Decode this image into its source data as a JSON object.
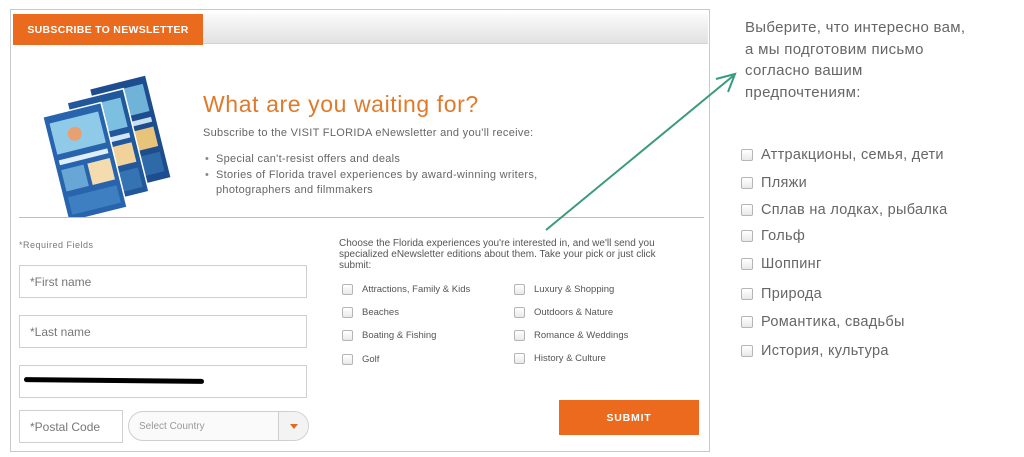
{
  "newsletter": {
    "tab_label": "SUBSCRIBE TO NEWSLETTER",
    "headline": "What are you waiting for?",
    "intro": "Subscribe to the VISIT FLORIDA eNewsletter and you'll receive:",
    "benefits": [
      {
        "lines": [
          "Special can't-resist offers and deals"
        ]
      },
      {
        "lines": [
          "Stories of Florida travel experiences by award-winning writers,",
          "photographers and filmmakers"
        ]
      }
    ],
    "accent_color": "#ea6a1e"
  },
  "form": {
    "required_label": "*Required Fields",
    "first_name_placeholder": "*First name",
    "last_name_placeholder": "*Last name",
    "postal_placeholder": "*Postal Code",
    "country_placeholder": "Select Country",
    "choose_text": [
      "Choose the Florida experiences you're interested in, and we'll send you",
      "specialized eNewsletter editions about them. Take your pick or just click",
      "submit:"
    ],
    "options": [
      "Attractions, Family & Kids",
      "Beaches",
      "Boating & Fishing",
      "Golf",
      "Luxury & Shopping",
      "Outdoors & Nature",
      "Romance & Weddings",
      "History & Culture"
    ],
    "submit_label": "SUBMIT"
  },
  "translation": {
    "prompt_lines": [
      "Выберите, что интересно вам,",
      "а мы подготовим письмо",
      "согласно вашим",
      "предпочтениям:"
    ],
    "options": [
      "Аттракционы, семья, дети",
      "Пляжи",
      "Сплав на лодках, рыбалка",
      "Гольф",
      "Шоппинг",
      "Природа",
      "Романтика, свадьбы",
      "История, культура"
    ],
    "arrow_color": "#3a9a7e"
  }
}
